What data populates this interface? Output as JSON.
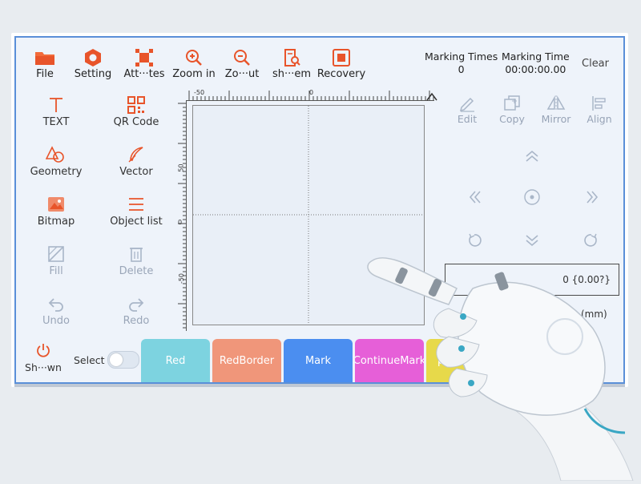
{
  "toolbar": {
    "file": "File",
    "setting": "Setting",
    "attributes": "Att···tes",
    "zoom_in": "Zoom in",
    "zoom_out": "Zo···ut",
    "show_item": "sh···em",
    "recovery": "Recovery"
  },
  "stats": {
    "marking_times_label": "Marking Times",
    "marking_times_value": "0",
    "marking_time_label": "Marking Time",
    "marking_time_value": "00:00:00.00",
    "clear_label": "Clear"
  },
  "left_tools": {
    "text": "TEXT",
    "qr_code": "QR Code",
    "geometry": "Geometry",
    "vector": "Vector",
    "bitmap": "Bitmap",
    "object_list": "Object list",
    "fill": "Fill",
    "delete": "Delete",
    "undo": "Undo",
    "redo": "Redo"
  },
  "rulers": {
    "top_left": "-50",
    "top_center": "0",
    "left_mid": "0",
    "left_upper": "50",
    "left_lower": "-50"
  },
  "right_tools": {
    "edit": "Edit",
    "copy": "Copy",
    "mirror": "Mirror",
    "align": "Align"
  },
  "coordinates": {
    "value": "0 {0.00?}",
    "unit": "(mm)"
  },
  "bottom": {
    "shutdown": "Sh···wn",
    "select": "Select",
    "buttons": [
      "Red",
      "RedBorder",
      "Mark",
      "ContinueMark",
      "powerOn"
    ]
  },
  "colors": {
    "red_btn": "#7dd3e0",
    "redborder_btn": "#f0967a",
    "mark_btn": "#4b8ef0",
    "continuemark_btn": "#e65fd8",
    "poweron_btn": "#e7d94a",
    "accent_icon": "#e85a2c",
    "frame": "#5a8fd8"
  }
}
